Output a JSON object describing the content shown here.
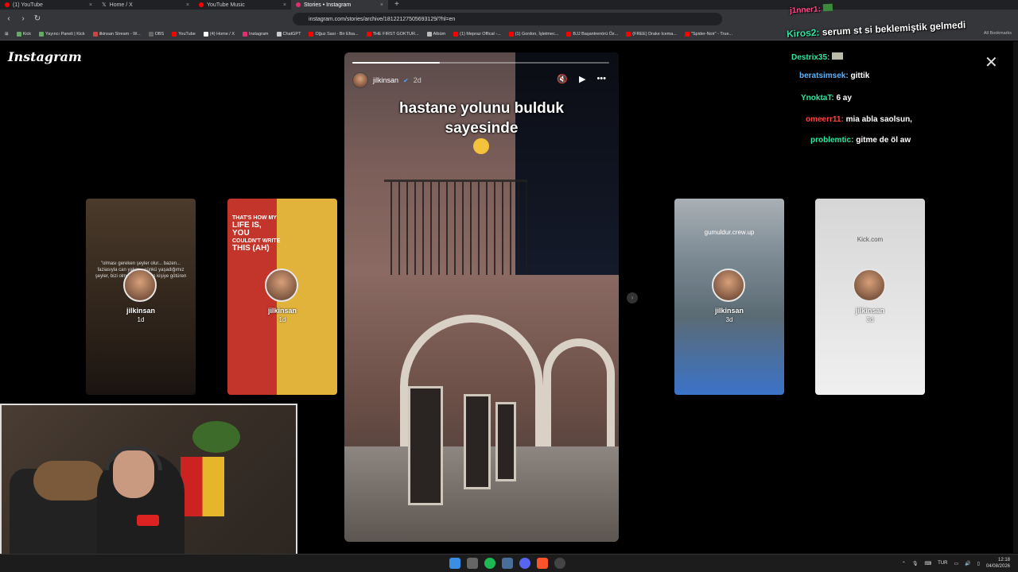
{
  "browser": {
    "tabs": [
      {
        "title": "(1) YouTube",
        "color": "#ff0000"
      },
      {
        "title": "Home / X",
        "color": "#ffffff"
      },
      {
        "title": "YouTube Music",
        "color": "#ff0000"
      },
      {
        "title": "Stories • Instagram",
        "color": "#e1306c",
        "active": true
      }
    ],
    "url": "instagram.com/stories/archive/18122127505693129/?hl=en",
    "bookmarks": [
      "Kick",
      "Yayıncı Paneli | Kick",
      "ilkinsan Stream - W...",
      "OBS",
      "YouTube",
      "(4) Home / X",
      "Instagram",
      "ChatGPT",
      "Oğuz Sasi - Bir Efsa...",
      "THE FIRST GOKTUR...",
      "Albüm",
      "(1) Mepraz Offical -...",
      "(1) Gordon, İşletmec...",
      "BJJ Başantrenörü Öz...",
      "(FREE) Drake Icema...",
      "\"Spider-Noir\" - True..."
    ],
    "all_bookmarks": "All Bookmarks"
  },
  "instagram": {
    "logo": "Instagram",
    "story": {
      "username": "jilkinsan",
      "time": "2d",
      "caption_line1": "hastane yolunu bulduk",
      "caption_line2": "sayesinde",
      "progress": 0.34
    },
    "thumbs": [
      {
        "username": "jilkinsan",
        "time": "1d",
        "text": "\"olması gereken şeyler olur... bazen... faziasıyla can yakar... çünkü yaşadığımız şeyler, bizi olmamız gereken kişiye götüren yolu açar.\""
      },
      {
        "username": "jilkinsan",
        "time": "1d",
        "top_line1": "THAT'S HOW MY",
        "top_big1": "LIFE IS,",
        "top_big2": "YOU",
        "top_line2": "COULDN'T WRITE",
        "top_big3": "THIS (AH)"
      },
      {
        "username": "jilkinsan",
        "time": "3d",
        "top": "gumuldur.crew.up"
      },
      {
        "username": "jilkinsan",
        "time": "3d",
        "top": "Kick.com"
      }
    ]
  },
  "chat": [
    {
      "user": "j1nner1:",
      "msg": "",
      "cls": "u1"
    },
    {
      "user": "Kiros2:",
      "msg": "serum st si beklemiştik gelmedi",
      "cls": "u2"
    },
    {
      "user": "Destrix35:",
      "msg": "",
      "cls": "u3"
    },
    {
      "user": "beratsimsek:",
      "msg": "gittik",
      "cls": "u4"
    },
    {
      "user": "YnoktaT:",
      "msg": "6 ay",
      "cls": "u5"
    },
    {
      "user": "omeerr11:",
      "msg": "mia abla saolsun,",
      "cls": "u6"
    },
    {
      "user": "problemtic:",
      "msg": "gitme de öl aw",
      "cls": "u7"
    }
  ],
  "taskbar": {
    "lang": "TUR",
    "time": "12:18",
    "date": "04/08/2026"
  }
}
